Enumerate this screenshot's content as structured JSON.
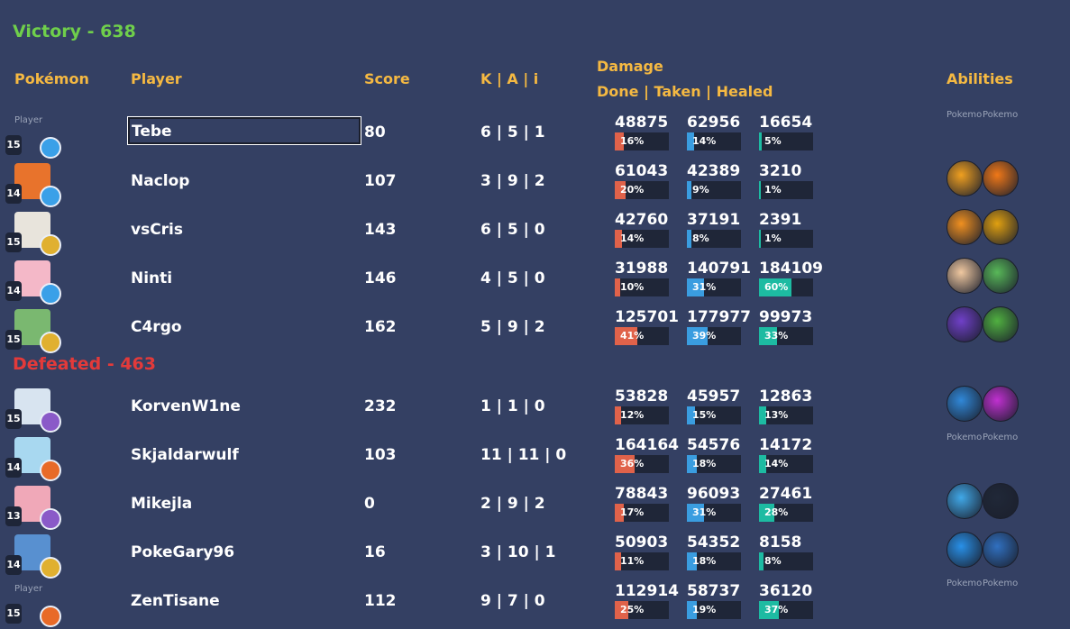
{
  "victory": {
    "label": "Victory - 638"
  },
  "defeat": {
    "label": "Defeated - 463"
  },
  "headers": {
    "pokemon": "Pokémon",
    "player": "Player",
    "score": "Score",
    "kai": "K | A | i",
    "damage": "Damage",
    "damage_sub": "Done | Taken | Healed",
    "abilities": "Abilities"
  },
  "broken_alt": {
    "player": "Player",
    "pokemon": "Pokemon"
  },
  "colors": {
    "done": "#e0624a",
    "taken": "#3a9de0",
    "healed": "#1dbba2"
  },
  "rows": [
    {
      "player": "Tebe",
      "score": "80",
      "kai": "6 | 5 | 1",
      "level": "15",
      "poke_broken": true,
      "poke_color": "",
      "item": "gem-blue",
      "done": "48875",
      "done_pct": "16%",
      "taken": "62956",
      "taken_pct": "14%",
      "healed": "16654",
      "healed_pct": "5%",
      "ability_broken": true,
      "a1": "",
      "a2": ""
    },
    {
      "player": "Naclop",
      "score": "107",
      "kai": "3 | 9 | 2",
      "level": "14",
      "poke_broken": false,
      "poke_color": "#e8732c",
      "item": "gem-blue",
      "done": "61043",
      "done_pct": "20%",
      "taken": "42389",
      "taken_pct": "9%",
      "healed": "3210",
      "healed_pct": "1%",
      "ability_broken": false,
      "a1": "#f0a020",
      "a2": "#f07818"
    },
    {
      "player": "vsCris",
      "score": "143",
      "kai": "6 | 5 | 0",
      "level": "15",
      "poke_broken": false,
      "poke_color": "#e8e4dc",
      "item": "gold",
      "done": "42760",
      "done_pct": "14%",
      "taken": "37191",
      "taken_pct": "8%",
      "healed": "2391",
      "healed_pct": "1%",
      "ability_broken": false,
      "a1": "#f09020",
      "a2": "#e0a010"
    },
    {
      "player": "Ninti",
      "score": "146",
      "kai": "4 | 5 | 0",
      "level": "14",
      "poke_broken": false,
      "poke_color": "#f4b8c8",
      "item": "gem-blue",
      "done": "31988",
      "done_pct": "10%",
      "taken": "140791",
      "taken_pct": "31%",
      "healed": "184109",
      "healed_pct": "60%",
      "ability_broken": false,
      "a1": "#f0c8a0",
      "a2": "#58b858"
    },
    {
      "player": "C4rgo",
      "score": "162",
      "kai": "5 | 9 | 2",
      "level": "15",
      "poke_broken": false,
      "poke_color": "#7ab870",
      "item": "gold",
      "done": "125701",
      "done_pct": "41%",
      "taken": "177977",
      "taken_pct": "39%",
      "healed": "99973",
      "healed_pct": "33%",
      "ability_broken": false,
      "a1": "#7040c8",
      "a2": "#50b040"
    },
    {
      "player": "KorvenW1ne",
      "score": "232",
      "kai": "1 | 1 | 0",
      "level": "15",
      "poke_broken": false,
      "poke_color": "#d8e4f0",
      "item": "potion",
      "done": "53828",
      "done_pct": "12%",
      "taken": "45957",
      "taken_pct": "15%",
      "healed": "12863",
      "healed_pct": "13%",
      "ability_broken": false,
      "a1": "#3088d8",
      "a2": "#c030d0"
    },
    {
      "player": "Skjaldarwulf",
      "score": "103",
      "kai": "11 | 11 | 0",
      "level": "14",
      "poke_broken": false,
      "poke_color": "#a8d8f0",
      "item": "orange",
      "done": "164164",
      "done_pct": "36%",
      "taken": "54576",
      "taken_pct": "18%",
      "healed": "14172",
      "healed_pct": "14%",
      "ability_broken": true,
      "a1": "",
      "a2": ""
    },
    {
      "player": "Mikejla",
      "score": "0",
      "kai": "2 | 9 | 2",
      "level": "13",
      "poke_broken": false,
      "poke_color": "#f0a8b8",
      "item": "potion",
      "done": "78843",
      "done_pct": "17%",
      "taken": "96093",
      "taken_pct": "31%",
      "healed": "27461",
      "healed_pct": "28%",
      "ability_broken": false,
      "a1": "#40a8e8",
      "a2": "#202838"
    },
    {
      "player": "PokeGary96",
      "score": "16",
      "kai": "3 | 10 | 1",
      "level": "14",
      "poke_broken": false,
      "poke_color": "#5890d0",
      "item": "gold",
      "done": "50903",
      "done_pct": "11%",
      "taken": "54352",
      "taken_pct": "18%",
      "healed": "8158",
      "healed_pct": "8%",
      "ability_broken": false,
      "a1": "#2890e8",
      "a2": "#3070c0"
    },
    {
      "player": "ZenTisane",
      "score": "112",
      "kai": "9 | 7 | 0",
      "level": "15",
      "poke_broken": true,
      "poke_color": "",
      "item": "orange",
      "done": "112914",
      "done_pct": "25%",
      "taken": "58737",
      "taken_pct": "19%",
      "healed": "36120",
      "healed_pct": "37%",
      "ability_broken": true,
      "a1": "",
      "a2": ""
    }
  ]
}
